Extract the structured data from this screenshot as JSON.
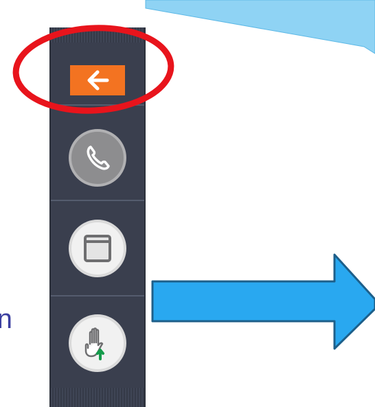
{
  "left_text": "n",
  "toolbar": {
    "buttons": [
      {
        "name": "back",
        "icon": "arrow-left-icon",
        "color": "#f37321"
      },
      {
        "name": "phone",
        "icon": "phone-icon"
      },
      {
        "name": "window",
        "icon": "window-icon"
      },
      {
        "name": "raise-hand",
        "icon": "raise-hand-icon"
      }
    ],
    "background": "#3a3f4e"
  },
  "annotations": {
    "highlight_color": "#e8141c",
    "arrow_color": "#29a8f0",
    "callout_color": "#8fd3f4"
  }
}
